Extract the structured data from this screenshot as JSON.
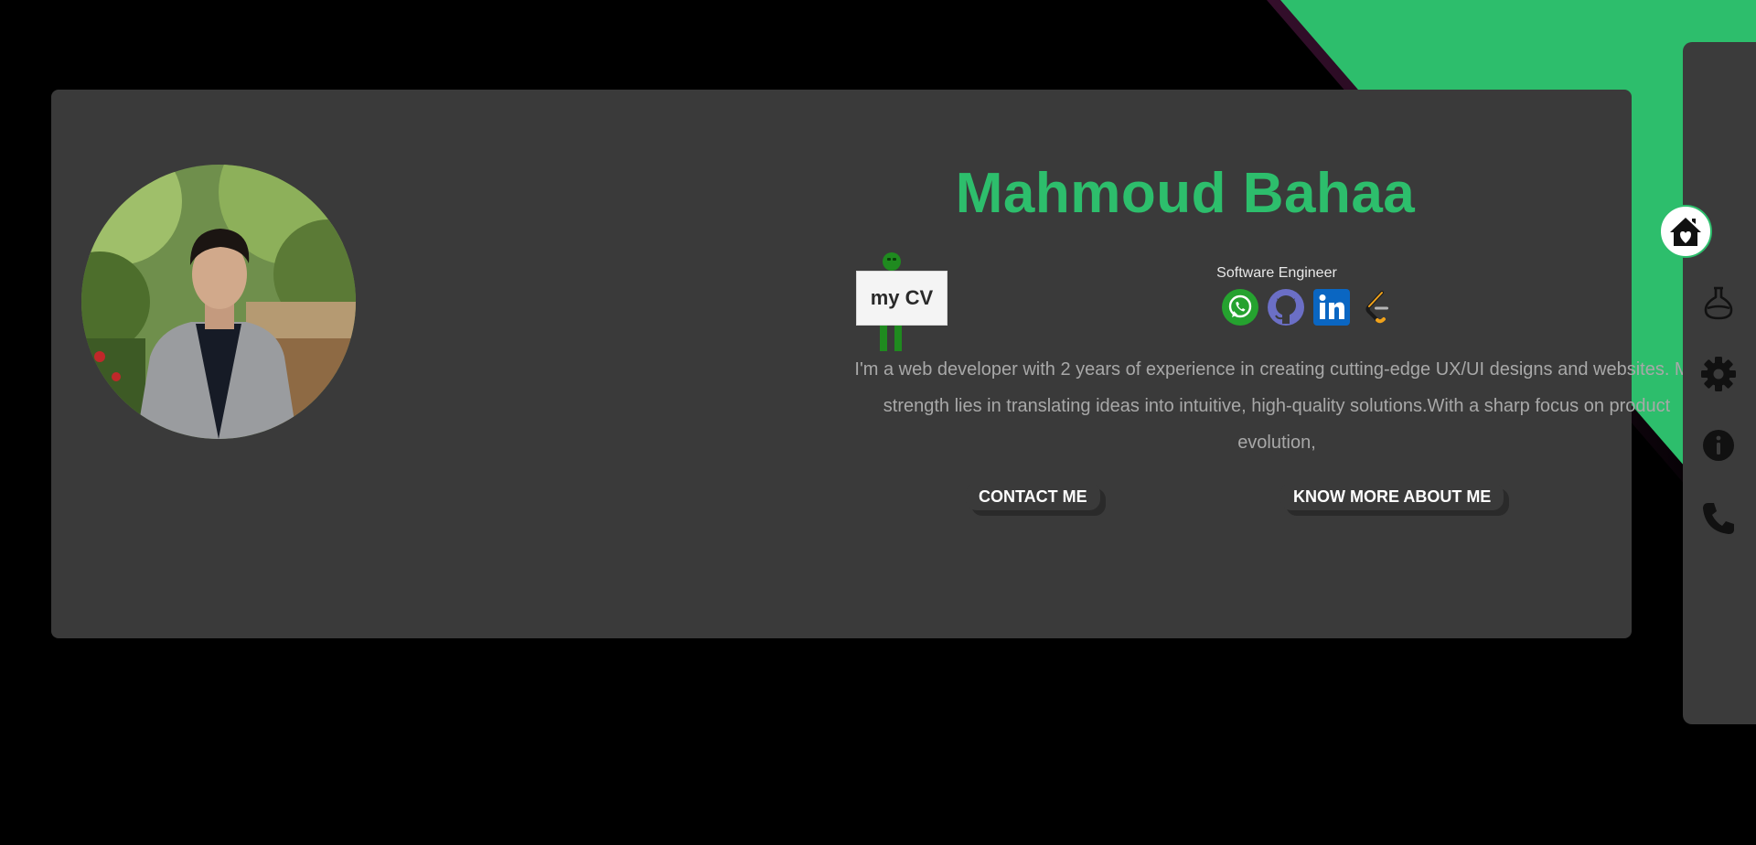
{
  "profile": {
    "name": "Mahmoud Bahaa",
    "role": "Software Engineer",
    "bio": "I'm a web developer with 2 years of experience in creating cutting-edge UX/UI designs and websites. My strength lies in translating ideas into intuitive, high-quality solutions.With a sharp focus on product evolution,",
    "avatar_icon": "profile-photo"
  },
  "cv": {
    "label": "my CV"
  },
  "buttons": {
    "contact": "CONTACT ME",
    "more": "KNOW MORE ABOUT ME"
  },
  "socials": [
    {
      "icon": "whatsapp-icon",
      "color": "#25a22f"
    },
    {
      "icon": "github-icon",
      "color": "#6b6fc6"
    },
    {
      "icon": "linkedin-icon",
      "color": "#0a66c2"
    },
    {
      "icon": "leetcode-icon",
      "color": "#f0a21b"
    }
  ],
  "nav": {
    "items": [
      {
        "icon": "home-icon",
        "active": true
      },
      {
        "icon": "flask-icon",
        "active": false
      },
      {
        "icon": "gear-icon",
        "active": false
      },
      {
        "icon": "info-icon",
        "active": false
      },
      {
        "icon": "phone-icon",
        "active": false
      }
    ]
  },
  "colors": {
    "accent": "#2dbe6c",
    "background": "#000000",
    "card": "#3a3a3a",
    "sidebar": "#3b3b3b",
    "bio_text": "#a8a8a8"
  }
}
